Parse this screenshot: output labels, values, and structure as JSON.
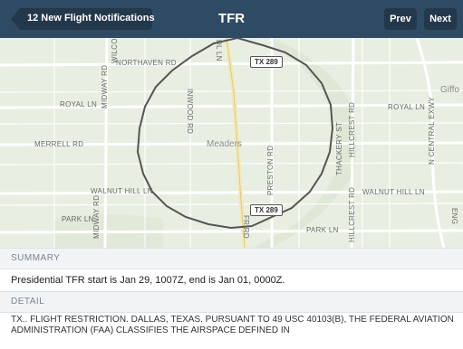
{
  "header": {
    "back_label": "12 New Flight Notifications",
    "title": "TFR",
    "prev_label": "Prev",
    "next_label": "Next"
  },
  "map": {
    "place_label": "Meaders",
    "city_label": "Giffo",
    "roads": {
      "northaven": "NORTHAVEN RD",
      "royal_left": "ROYAL LN",
      "royal_right": "ROYAL LN",
      "merrell": "MERRELL RD",
      "walnut_hill_left": "WALNUT HILL LN",
      "walnut_hill_right": "WALNUT HILL LN",
      "park_left": "PARK LN",
      "park_right": "PARK LN",
      "midway_upper": "MIDWAY RD",
      "midway_lower": "MIDWAY RD",
      "inwood": "INWOOD RD",
      "preston": "PRESTON RD",
      "thackery": "THACKERY ST",
      "hillcrest_upper": "HILLCREST RD",
      "hillcrest_lower": "HILLCREST RD",
      "central": "N CENTRAL EXWY",
      "wilco": "WILCO",
      "dl": "DL LN",
      "fr": "FR RD",
      "eng": "ENG"
    },
    "shields": {
      "top": "TX 289",
      "bottom": "TX 289"
    },
    "colors": {
      "background": "#e8efe2",
      "road": "#ffffff",
      "highway": "#f3e9b6",
      "boundary": "#555555"
    }
  },
  "summary": {
    "header": "SUMMARY",
    "text": "Presidential TFR start is Jan 29, 1007Z, end is Jan 01, 0000Z."
  },
  "detail": {
    "header": "DETAIL",
    "text": "TX.. FLIGHT RESTRICTION. DALLAS, TEXAS. PURSUANT TO 49 USC 40103(B), THE FEDERAL AVIATION ADMINISTRATION (FAA) CLASSIFIES THE AIRSPACE DEFINED IN"
  }
}
